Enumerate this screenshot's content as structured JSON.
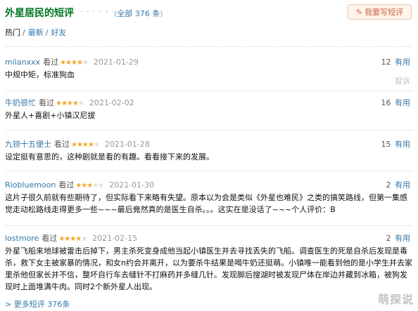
{
  "header": {
    "title": "外星居民的短评",
    "dots": "· · · · · ·",
    "total_prefix": "(",
    "total_link": "全部 376 条",
    "total_suffix": ")",
    "write_button": "我要写短评"
  },
  "sorts": [
    {
      "label": "热门",
      "active": true
    },
    {
      "label": "最新",
      "active": false
    },
    {
      "label": "好友",
      "active": false
    }
  ],
  "sort_separator": "/",
  "comments": [
    {
      "user": "milanxxx",
      "watched": "看过",
      "rating": 4,
      "date": "2021-01-29",
      "votes": "12",
      "useful": "有用",
      "text": "中规中矩，标准狗血",
      "report": "投诉"
    },
    {
      "user": "牛奶很忙",
      "watched": "看过",
      "rating": 4,
      "date": "2021-02-02",
      "votes": "16",
      "useful": "有用",
      "text": "外星人+喜剧+小镇汉尼拔"
    },
    {
      "user": "九镑十五便士",
      "watched": "看过",
      "rating": 4,
      "date": "2021-01-28",
      "votes": "15",
      "useful": "有用",
      "text": "设定挺有意思的，这种剧就是看的有趣。看看接下来的发展。"
    },
    {
      "user": "Riobluemoon",
      "watched": "看过",
      "rating": 3,
      "date": "2021-01-30",
      "votes": "2",
      "useful": "有用",
      "text": "这片子很久前就有些期待了，但实际看下来略有失望。原本以为会是类似《外星也难民》之类的搞笑路线，但第一集感觉走动松路线走得更多一些~~~最后竟然真的是医生自杀。。。这实在是没话了~~~个人评价：B"
    },
    {
      "user": "lostmore",
      "watched": "看过",
      "rating": 4,
      "date": "2021-02-15",
      "votes": "2",
      "useful": "有用",
      "text": "外星飞船来地球被雷击后掉下，男主杀死变身成他当起小镇医生并去寻找丢失的飞船。调查医生的死是自杀后发现是毒杀，救下女主被家暴的情况，和女n约会并离开，以为要杀牛结果是喝牛奶还挺萌。小镇唯一能看到他的是小学生并去家里杀他但家长并不信，整坏自行车去缝针不打麻药并多缝几针。发现脚后搜湖时被发现尸体在岸边并藏到冰箱，被狗发现时上面堆满牛肉。同时2个新外星人出现。"
    }
  ],
  "more_link": "更多短评 376条",
  "watermark": "萌探说",
  "colors": {
    "accent_green": "#007722",
    "link_blue": "#3377aa",
    "star": "#f5a623",
    "button_bg": "#fff3ea",
    "button_text": "#ca6445"
  }
}
